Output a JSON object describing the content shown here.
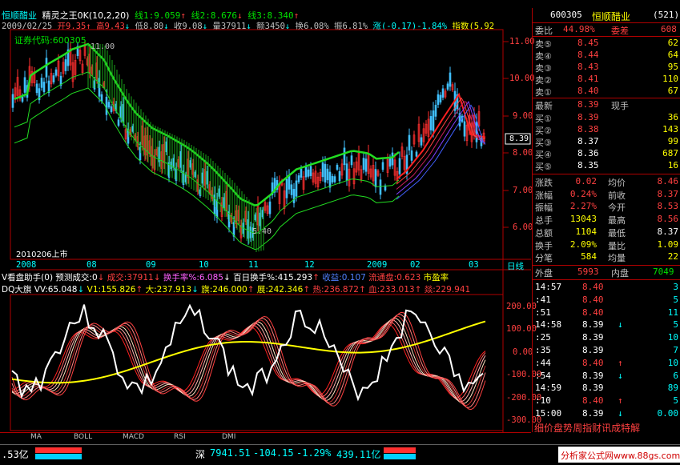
{
  "stock": {
    "name": "恒顺醋业",
    "indicator_name": "精灵之王0K(10,2,20)"
  },
  "header": {
    "line1": "线1:9.059",
    "line2": "线2:8.676",
    "line3": "线3:8.340",
    "date": "2009/02/25",
    "open": "开9.35",
    "high": "高9.43",
    "low": "低8.80",
    "close": "收9.08",
    "vol": "量37911",
    "amount": "额3450",
    "turnover": "换6.08%",
    "amplitude": "振6.81%",
    "change": "涨(-0.17)-1.84%",
    "index_label": "指数(5.92"
  },
  "chart_labels": {
    "code_label": "证券代码:600305",
    "high_mark": "11.00",
    "low_mark": "5.40",
    "listing": "2010206上市",
    "price_tag": "8.39"
  },
  "price_axis": [
    "11.00",
    "10.00",
    "9.00",
    "8.00",
    "7.00",
    "6.00"
  ],
  "time_axis": [
    "2008",
    "08",
    "09",
    "10",
    "11",
    "12",
    "2009",
    "02",
    "03"
  ],
  "time_axis_right": "日线",
  "vol_indicator": {
    "title": "V看盘助手(0)",
    "pred": "预测成交:0",
    "chengjiao": "成交:37911",
    "huanshou": "换手率%:6.085",
    "bairi": "百日换手%:415.293",
    "shouyi": "收益:0.107",
    "liutong": "流通盘:0.623",
    "shiying": "市盈率"
  },
  "dq_indicator": {
    "title": "DQ大旗",
    "vv": "VV:65.048",
    "v1": "V1:155.826",
    "da": "大:237.913",
    "qi": "旗:246.000",
    "zhan": "展:242.346",
    "re": "热:236.872",
    "xue": "血:233.013",
    "liang": "燚:229.941"
  },
  "osc_axis": [
    "200.00",
    "100.00",
    "0.00",
    "-100.00",
    "-200.00",
    "-300.00"
  ],
  "bottom_tabs": [
    "MA",
    "BOLL",
    "MACD",
    "RSI",
    "DMI"
  ],
  "status_bar": {
    "left": ".53亿",
    "market": "深",
    "index": "7941.51",
    "change": "-104.15",
    "pct": "-1.29%",
    "amount": "439.11亿",
    "watermark": "分析家公式网www.88gs.com"
  },
  "right_panel": {
    "code": "600305",
    "name": "恒顺醋业",
    "seq": "(521)",
    "weibi_label": "委比",
    "weibi": "44.98%",
    "weicha_label": "委差",
    "weicha": "608",
    "asks": [
      {
        "label": "卖⑤",
        "price": "8.45",
        "vol": "62"
      },
      {
        "label": "卖④",
        "price": "8.44",
        "vol": "64"
      },
      {
        "label": "卖③",
        "price": "8.43",
        "vol": "95"
      },
      {
        "label": "卖②",
        "price": "8.41",
        "vol": "110"
      },
      {
        "label": "卖①",
        "price": "8.40",
        "vol": "67"
      }
    ],
    "latest_label": "最新",
    "latest": "8.39",
    "xianshou_label": "现手",
    "bids": [
      {
        "label": "买①",
        "price": "8.39",
        "vol": "36"
      },
      {
        "label": "买②",
        "price": "8.38",
        "vol": "143"
      },
      {
        "label": "买③",
        "price": "8.37",
        "vol": "99"
      },
      {
        "label": "买④",
        "price": "8.36",
        "vol": "687"
      },
      {
        "label": "买⑤",
        "price": "8.35",
        "vol": "16"
      }
    ],
    "stats": [
      {
        "l1": "涨跌",
        "v1": "0.02",
        "l2": "均价",
        "v2": "8.46"
      },
      {
        "l1": "涨幅",
        "v1": "0.24%",
        "l2": "前收",
        "v2": "8.37"
      },
      {
        "l1": "振幅",
        "v1": "2.27%",
        "l2": "今开",
        "v2": "8.53"
      },
      {
        "l1": "总手",
        "v1": "13043",
        "l2": "最高",
        "v2": "8.56"
      },
      {
        "l1": "总额",
        "v1": "1104",
        "l2": "最低",
        "v2": "8.37"
      },
      {
        "l1": "换手",
        "v1": "2.09%",
        "l2": "量比",
        "v2": "1.09"
      },
      {
        "l1": "分笔",
        "v1": "584",
        "l2": "均量",
        "v2": "22"
      }
    ],
    "waipan_label": "外盘",
    "waipan": "5993",
    "neipan_label": "内盘",
    "neipan": "7049",
    "ticks": [
      {
        "t": "14:57",
        "p": "8.40",
        "a": "",
        "v": "3"
      },
      {
        "t": ":41",
        "p": "8.40",
        "a": "",
        "v": "5"
      },
      {
        "t": ":51",
        "p": "8.40",
        "a": "",
        "v": "11"
      },
      {
        "t": "14:58",
        "p": "8.39",
        "a": "↓",
        "v": "5"
      },
      {
        "t": ":25",
        "p": "8.39",
        "a": "",
        "v": "10"
      },
      {
        "t": ":35",
        "p": "8.39",
        "a": "",
        "v": "7"
      },
      {
        "t": ":44",
        "p": "8.40",
        "a": "↑",
        "v": "10"
      },
      {
        "t": ":54",
        "p": "8.39",
        "a": "↓",
        "v": "6"
      },
      {
        "t": "14:59",
        "p": "8.39",
        "a": "",
        "v": "89"
      },
      {
        "t": ":10",
        "p": "8.40",
        "a": "↑",
        "v": "5"
      },
      {
        "t": "15:00",
        "p": "8.39",
        "a": "↓",
        "v": "0.00"
      }
    ],
    "bottom_tabs": [
      "细",
      "价",
      "盘",
      "势",
      "周",
      "指",
      "财",
      "讯",
      "成",
      "特",
      "解"
    ]
  }
}
